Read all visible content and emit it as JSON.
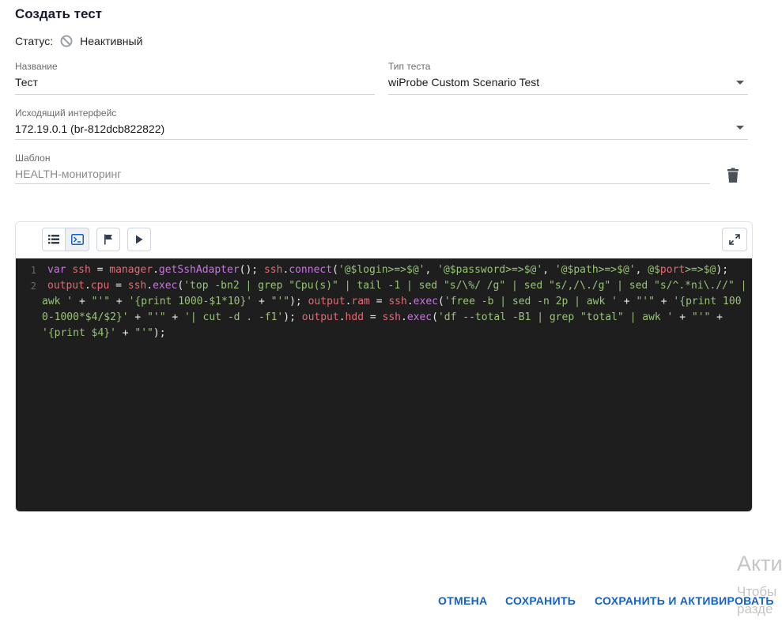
{
  "page": {
    "title": "Создать тест"
  },
  "status": {
    "label": "Статус:",
    "value": "Неактивный",
    "icon": "inactive-icon"
  },
  "fields": {
    "name": {
      "label": "Название",
      "value": "Тест"
    },
    "test_type": {
      "label": "Тип теста",
      "value": "wiProbe Custom Scenario Test"
    },
    "interface": {
      "label": "Исходящий интерфейс",
      "value": "172.19.0.1 (br-812dcb822822)"
    },
    "template": {
      "label": "Шаблон",
      "value": "HEALTH-мониторинг"
    }
  },
  "editor": {
    "toolbar": [
      "list-icon",
      "terminal-icon",
      "flag-icon",
      "play-icon",
      "expand-icon"
    ],
    "lines": [
      {
        "number": "1",
        "tokens": [
          {
            "t": "var ",
            "c": "kw"
          },
          {
            "t": "ssh",
            "c": "var"
          },
          {
            "t": " = ",
            "c": "pl"
          },
          {
            "t": "manager",
            "c": "var"
          },
          {
            "t": ".",
            "c": "pl"
          },
          {
            "t": "getSshAdapter",
            "c": "fn"
          },
          {
            "t": "(); ",
            "c": "pl"
          },
          {
            "t": "ssh",
            "c": "var"
          },
          {
            "t": ".",
            "c": "pl"
          },
          {
            "t": "connect",
            "c": "fn"
          },
          {
            "t": "(",
            "c": "pl"
          },
          {
            "t": "'@$login>=>$@'",
            "c": "str"
          },
          {
            "t": ", ",
            "c": "pl"
          },
          {
            "t": "'@$password>=>$@'",
            "c": "str"
          },
          {
            "t": ", ",
            "c": "pl"
          },
          {
            "t": "'@$path>=>$@'",
            "c": "str"
          },
          {
            "t": ", ",
            "c": "pl"
          },
          {
            "t": "@$",
            "c": "str"
          },
          {
            "t": "port",
            "c": "var"
          },
          {
            "t": ">=>$@",
            "c": "str"
          },
          {
            "t": ");",
            "c": "pl"
          }
        ]
      },
      {
        "number": "2",
        "tokens": [
          {
            "t": "output",
            "c": "var"
          },
          {
            "t": ".",
            "c": "pl"
          },
          {
            "t": "cpu",
            "c": "var"
          },
          {
            "t": " = ",
            "c": "pl"
          },
          {
            "t": "ssh",
            "c": "var"
          },
          {
            "t": ".",
            "c": "pl"
          },
          {
            "t": "exec",
            "c": "fn"
          },
          {
            "t": "(",
            "c": "pl"
          },
          {
            "t": "'top -bn2 | grep \"Cpu(s)\" | tail -1 | sed \"s/\\%/ /g\" | sed \"s/,/\\./g\" | sed \"s/^.*ni\\.//\" | awk '",
            "c": "str"
          },
          {
            "t": " + ",
            "c": "pl"
          },
          {
            "t": "\"'\"",
            "c": "str"
          },
          {
            "t": " + ",
            "c": "pl"
          },
          {
            "t": "'{print 1000-$1*10}'",
            "c": "str"
          },
          {
            "t": " + ",
            "c": "pl"
          },
          {
            "t": "\"'\"",
            "c": "str"
          },
          {
            "t": "); ",
            "c": "pl"
          },
          {
            "t": "output",
            "c": "var"
          },
          {
            "t": ".",
            "c": "pl"
          },
          {
            "t": "ram",
            "c": "var"
          },
          {
            "t": " = ",
            "c": "pl"
          },
          {
            "t": "ssh",
            "c": "var"
          },
          {
            "t": ".",
            "c": "pl"
          },
          {
            "t": "exec",
            "c": "fn"
          },
          {
            "t": "(",
            "c": "pl"
          },
          {
            "t": "'free -b | sed -n 2p | awk '",
            "c": "str"
          },
          {
            "t": " + ",
            "c": "pl"
          },
          {
            "t": "\"'\"",
            "c": "str"
          },
          {
            "t": " + ",
            "c": "pl"
          },
          {
            "t": "'{print 1000-1000*$4/$2}'",
            "c": "str"
          },
          {
            "t": " + ",
            "c": "pl"
          },
          {
            "t": "\"'\"",
            "c": "str"
          },
          {
            "t": " + ",
            "c": "pl"
          },
          {
            "t": "'| cut -d . -f1'",
            "c": "str"
          },
          {
            "t": "); ",
            "c": "pl"
          },
          {
            "t": "output",
            "c": "var"
          },
          {
            "t": ".",
            "c": "pl"
          },
          {
            "t": "hdd",
            "c": "var"
          },
          {
            "t": " = ",
            "c": "pl"
          },
          {
            "t": "ssh",
            "c": "var"
          },
          {
            "t": ".",
            "c": "pl"
          },
          {
            "t": "exec",
            "c": "fn"
          },
          {
            "t": "(",
            "c": "pl"
          },
          {
            "t": "'df --total -B1 | grep \"total\" | awk '",
            "c": "str"
          },
          {
            "t": " + ",
            "c": "pl"
          },
          {
            "t": "\"'\"",
            "c": "str"
          },
          {
            "t": " + ",
            "c": "pl"
          },
          {
            "t": "'{print $4}'",
            "c": "str"
          },
          {
            "t": " + ",
            "c": "pl"
          },
          {
            "t": "\"'\"",
            "c": "str"
          },
          {
            "t": ");",
            "c": "pl"
          }
        ]
      }
    ]
  },
  "actions": {
    "cancel": "ОТМЕНА",
    "save": "СОХРАНИТЬ",
    "save_activate": "СОХРАНИТЬ И АКТИВИРОВАТЬ"
  },
  "watermark": {
    "line1": "Акти",
    "line2": "Чтобы",
    "line3": "разде"
  },
  "colors": {
    "accent": "#1560c9",
    "editor_bg": "#1e1e1e"
  }
}
